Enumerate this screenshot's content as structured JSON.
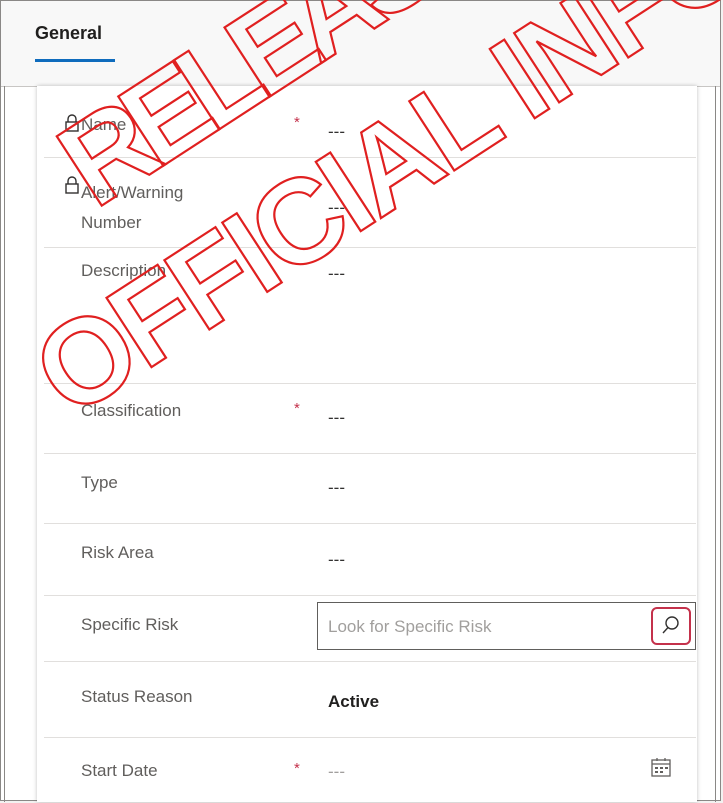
{
  "tabs": [
    {
      "label": "General"
    }
  ],
  "fields": {
    "name": {
      "label": "Name",
      "value": "---",
      "required_mark": "*"
    },
    "alert_number": {
      "label_line1": "Alert/Warning",
      "label_line2": "Number",
      "value": "---"
    },
    "description": {
      "label": "Description",
      "value": "---"
    },
    "classification": {
      "label": "Classification",
      "value": "---",
      "required_mark": "*"
    },
    "type": {
      "label": "Type",
      "value": "---"
    },
    "risk_area": {
      "label": "Risk Area",
      "value": "---"
    },
    "specific_risk": {
      "label": "Specific Risk",
      "placeholder": "Look for Specific Risk"
    },
    "status_reason": {
      "label": "Status Reason",
      "value": "Active"
    },
    "start_date": {
      "label": "Start Date",
      "value": "---",
      "required_mark": "*"
    }
  },
  "watermark": {
    "line1": "RELEASED",
    "line2": "OFFICIAL INFO"
  },
  "icons": {
    "lock": "lock-icon",
    "search": "search-icon",
    "calendar": "calendar-icon"
  },
  "colors": {
    "accent": "#0f6cbd",
    "required": "#c4314b",
    "watermark": "#e02020"
  }
}
